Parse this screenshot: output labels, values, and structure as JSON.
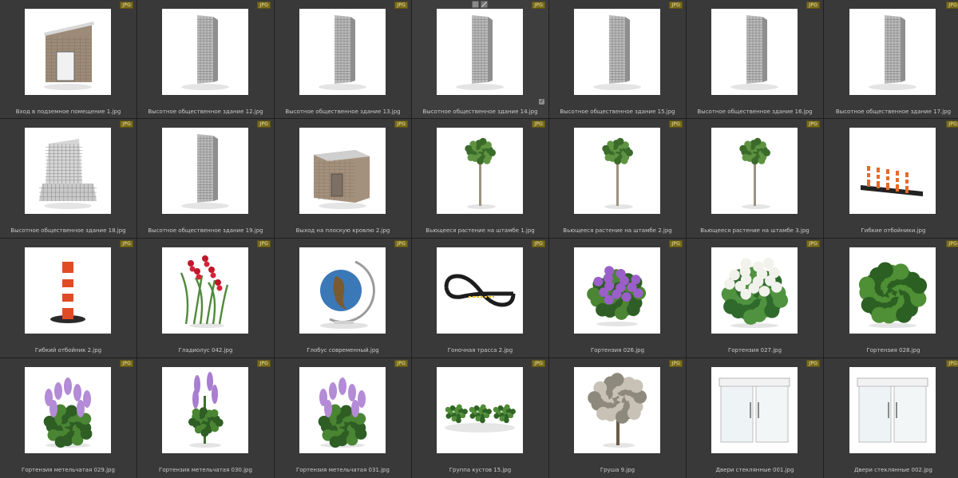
{
  "badge_label": "JPG",
  "items": [
    {
      "name": "Вход в подземное помещение 1.jpg",
      "icon": "brick-booth-icon"
    },
    {
      "name": "Высотное общественное здание 12.jpg",
      "icon": "tower-icon"
    },
    {
      "name": "Высотное общественное здание 13.jpg",
      "icon": "tower-icon"
    },
    {
      "name": "Высотное общественное здание 14.jpg",
      "icon": "tower-icon"
    },
    {
      "name": "Высотное общественное здание 15.jpg",
      "icon": "tower-icon"
    },
    {
      "name": "Высотное общественное здание 16.jpg",
      "icon": "tower-icon"
    },
    {
      "name": "Высотное общественное здание 17.jpg",
      "icon": "tower-icon"
    },
    {
      "name": "Высотное общественное здание 18.jpg",
      "icon": "stepped-building-icon"
    },
    {
      "name": "Высотное общественное здание 19.jpg",
      "icon": "tower-icon"
    },
    {
      "name": "Выход на плоскую кровлю 2.jpg",
      "icon": "brick-box-icon"
    },
    {
      "name": "Вьющееся растение на штамбе 1.jpg",
      "icon": "standard-tree-icon"
    },
    {
      "name": "Вьющееся растение на штамбе 2.jpg",
      "icon": "standard-tree-icon"
    },
    {
      "name": "Вьющееся растение на штамбе 3.jpg",
      "icon": "standard-tree-icon"
    },
    {
      "name": "Гибкие отбойники.jpg",
      "icon": "bollard-row-icon"
    },
    {
      "name": "Гибкий отбойник 2.jpg",
      "icon": "bollard-icon"
    },
    {
      "name": "Гладиолус 042.jpg",
      "icon": "gladiolus-icon"
    },
    {
      "name": "Глобус современный.jpg",
      "icon": "globe-icon"
    },
    {
      "name": "Гоночная трасса 2.jpg",
      "icon": "race-track-icon"
    },
    {
      "name": "Гортензия 026.jpg",
      "icon": "hydrangea-purple-icon"
    },
    {
      "name": "Гортензия 027.jpg",
      "icon": "hydrangea-white-icon"
    },
    {
      "name": "Гортензия 028.jpg",
      "icon": "shrub-green-icon"
    },
    {
      "name": "Гортензия метельчатая 029.jpg",
      "icon": "lilac-shrub-icon"
    },
    {
      "name": "Гортензия метельчатая 030.jpg",
      "icon": "lilac-spikes-icon"
    },
    {
      "name": "Гортензия метельчатая 031.jpg",
      "icon": "lilac-shrub-icon"
    },
    {
      "name": "Группа кустов 15.jpg",
      "icon": "bush-group-icon"
    },
    {
      "name": "Груша 9.jpg",
      "icon": "pear-tree-icon"
    },
    {
      "name": "Двери стеклянные 001.jpg",
      "icon": "glass-door-icon"
    },
    {
      "name": "Двери стеклянные 002.jpg",
      "icon": "glass-door-icon"
    }
  ],
  "selected_index": 3
}
